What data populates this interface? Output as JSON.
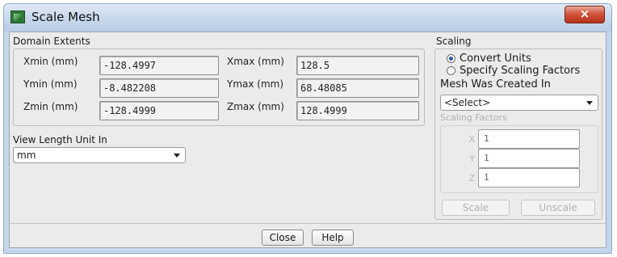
{
  "window": {
    "title": "Scale Mesh",
    "close_glyph": "×"
  },
  "domain_extents": {
    "label": "Domain Extents",
    "xmin": {
      "label": "Xmin (mm)",
      "value": "-128.4997"
    },
    "xmax": {
      "label": "Xmax (mm)",
      "value": "128.5"
    },
    "ymin": {
      "label": "Ymin (mm)",
      "value": "-8.482208"
    },
    "ymax": {
      "label": "Ymax (mm)",
      "value": "68.48085"
    },
    "zmin": {
      "label": "Zmin (mm)",
      "value": "-128.4999"
    },
    "zmax": {
      "label": "Zmax (mm)",
      "value": "128.4999"
    }
  },
  "view_length_unit": {
    "label": "View Length Unit In",
    "selected": "mm"
  },
  "scaling": {
    "label": "Scaling",
    "options": [
      {
        "label": "Convert Units",
        "checked": true
      },
      {
        "label": "Specify Scaling Factors",
        "checked": false
      }
    ],
    "mesh_created_in": {
      "label": "Mesh Was Created In",
      "selected": "<Select>"
    },
    "scaling_factors": {
      "label": "Scaling Factors",
      "x": {
        "label": "X",
        "value": "1"
      },
      "y": {
        "label": "Y",
        "value": "1"
      },
      "z": {
        "label": "Z",
        "value": "1"
      }
    },
    "scale_label": "Scale",
    "unscale_label": "Unscale"
  },
  "buttons": {
    "close_label": "Close",
    "help_label": "Help"
  }
}
